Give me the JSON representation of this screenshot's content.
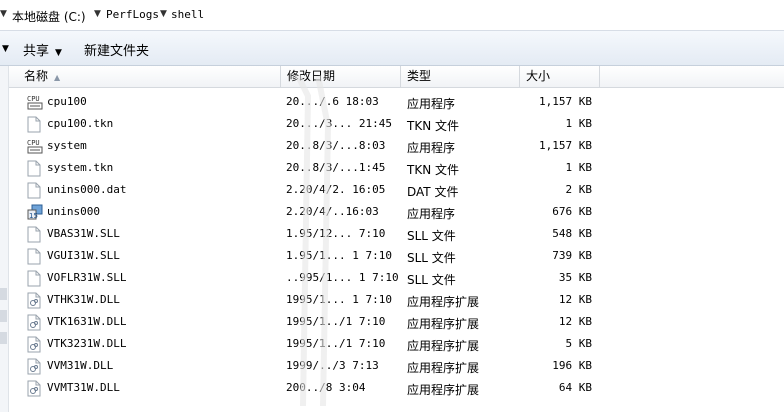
{
  "breadcrumb": {
    "drive": "本地磁盘 (C:)",
    "folder1": "PerfLogs",
    "folder2": "shell"
  },
  "toolbar": {
    "share": "共享",
    "new_folder": "新建文件夹"
  },
  "columns": {
    "name": "名称",
    "date": "修改日期",
    "type": "类型",
    "size": "大小"
  },
  "files": [
    {
      "name": "cpu100",
      "date": "20.../.6 18:03",
      "type": "应用程序",
      "size": "1,157 KB",
      "icon": "exe-icon"
    },
    {
      "name": "cpu100.tkn",
      "date": "20.../3... 21:45",
      "type": "TKN 文件",
      "size": "1 KB",
      "icon": "file-icon"
    },
    {
      "name": "system",
      "date": "20..8/3/...8:03",
      "type": "应用程序",
      "size": "1,157 KB",
      "icon": "exe-icon"
    },
    {
      "name": "system.tkn",
      "date": "20..8/3/...1:45",
      "type": "TKN 文件",
      "size": "1 KB",
      "icon": "file-icon"
    },
    {
      "name": "unins000.dat",
      "date": "2.20/4/2. 16:05",
      "type": "DAT 文件",
      "size": "2 KB",
      "icon": "file-icon"
    },
    {
      "name": "unins000",
      "date": "2.20/4/..16:03",
      "type": "应用程序",
      "size": "676 KB",
      "icon": "installer-icon"
    },
    {
      "name": "VBAS31W.SLL",
      "date": "1.95/12... 7:10",
      "type": "SLL 文件",
      "size": "548 KB",
      "icon": "file-icon"
    },
    {
      "name": "VGUI31W.SLL",
      "date": "1.95/1... 1 7:10",
      "type": "SLL 文件",
      "size": "739 KB",
      "icon": "file-icon"
    },
    {
      "name": "VOFLR31W.SLL",
      "date": "..995/1... 1 7:10",
      "type": "SLL 文件",
      "size": "35 KB",
      "icon": "file-icon"
    },
    {
      "name": "VTHK31W.DLL",
      "date": "1995/1... 1 7:10",
      "type": "应用程序扩展",
      "size": "12 KB",
      "icon": "dll-icon"
    },
    {
      "name": "VTK1631W.DLL",
      "date": "1995/1../1 7:10",
      "type": "应用程序扩展",
      "size": "12 KB",
      "icon": "dll-icon"
    },
    {
      "name": "VTK3231W.DLL",
      "date": "1995/1../1 7:10",
      "type": "应用程序扩展",
      "size": "5 KB",
      "icon": "dll-icon"
    },
    {
      "name": "VVM31W.DLL",
      "date": "1999/../3 7:13",
      "type": "应用程序扩展",
      "size": "196 KB",
      "icon": "dll-icon"
    },
    {
      "name": "VVMT31W.DLL",
      "date": "200../8 3:04",
      "type": "应用程序扩展",
      "size": "64 KB",
      "icon": "dll-icon"
    }
  ]
}
